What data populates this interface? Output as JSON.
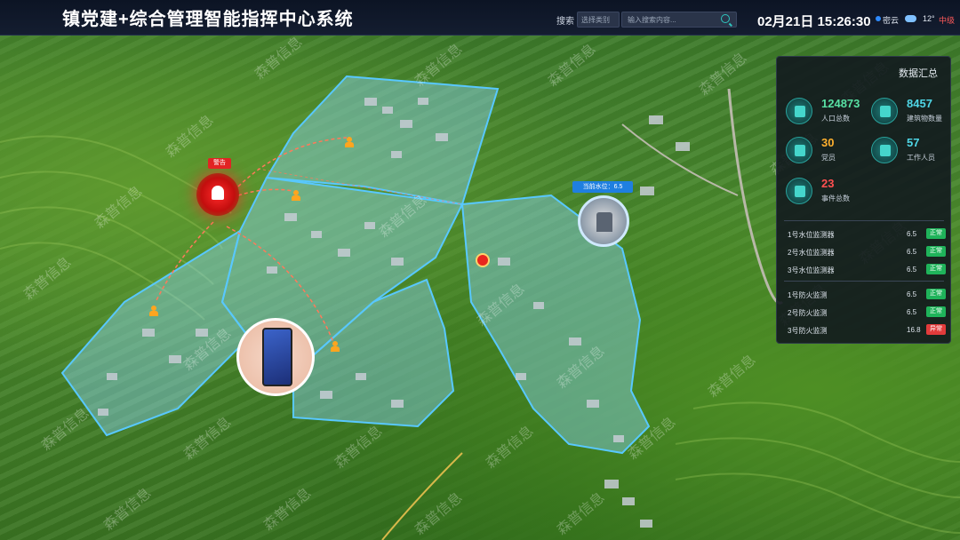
{
  "header": {
    "title": "镇党建+综合管理智能指挥中心系统",
    "search_label": "搜索",
    "search_select": "选择类别",
    "search_placeholder": "输入搜索内容...",
    "datetime": "02月21日 15:26:30",
    "location": "密云",
    "temperature": "12°",
    "air_quality": "中级"
  },
  "panel": {
    "title": "数据汇总",
    "stats": [
      {
        "value": "124873",
        "label": "人口总数",
        "color": "#58e1a4"
      },
      {
        "value": "8457",
        "label": "建筑物数量",
        "color": "#4fd6e6"
      },
      {
        "value": "30",
        "label": "党员",
        "color": "#ffb02e"
      },
      {
        "value": "57",
        "label": "工作人员",
        "color": "#4fd6e6"
      },
      {
        "value": "23",
        "label": "事件总数",
        "color": "#ff5050"
      }
    ],
    "water_monitors": [
      {
        "name": "1号水位监测器",
        "value": "6.5",
        "status": "正常"
      },
      {
        "name": "2号水位监测器",
        "value": "6.5",
        "status": "正常"
      },
      {
        "name": "3号水位监测器",
        "value": "6.5",
        "status": "正常"
      }
    ],
    "fire_monitors": [
      {
        "name": "1号防火监测",
        "value": "6.5",
        "status": "正常"
      },
      {
        "name": "2号防火监测",
        "value": "6.5",
        "status": "正常"
      },
      {
        "name": "3号防火监测",
        "value": "16.8",
        "status": "异常"
      }
    ]
  },
  "map": {
    "alarm_label": "警告",
    "water_level_label": "当前水位：6.5"
  },
  "watermark": "森普信息",
  "colors": {
    "zone_fill": "#8fd8ff",
    "zone_stroke": "#58c8ff",
    "alarm": "#e02424",
    "ok": "#1fb35a",
    "bad": "#e23b3b"
  }
}
